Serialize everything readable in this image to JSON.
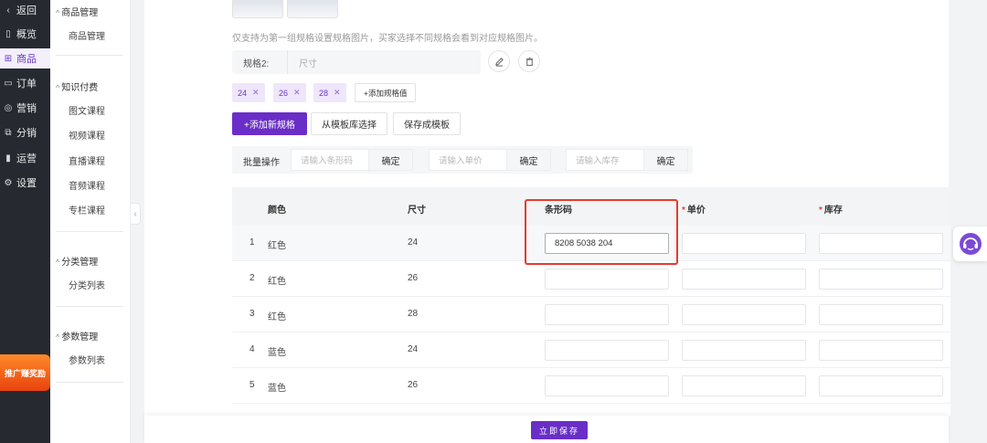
{
  "nav": {
    "items": [
      {
        "icon": "chevron-left-icon",
        "glyph": "‹",
        "label": "返回"
      },
      {
        "icon": "overview-icon",
        "glyph": "▯",
        "label": "概览"
      },
      {
        "icon": "goods-icon",
        "glyph": "⊞",
        "label": "商品",
        "active": true
      },
      {
        "icon": "order-icon",
        "glyph": "▭",
        "label": "订单"
      },
      {
        "icon": "marketing-icon",
        "glyph": "◎",
        "label": "营销"
      },
      {
        "icon": "distribution-icon",
        "glyph": "⧉",
        "label": "分销"
      },
      {
        "icon": "operation-icon",
        "glyph": "▮",
        "label": "运营"
      },
      {
        "icon": "settings-icon",
        "glyph": "⚙",
        "label": "设置"
      }
    ],
    "promo": "推广赚奖励"
  },
  "submenu": {
    "groups": [
      {
        "title": "商品管理",
        "items": [
          "商品管理"
        ]
      },
      {
        "title": "知识付费",
        "items": [
          "图文课程",
          "视频课程",
          "直播课程",
          "音频课程",
          "专栏课程"
        ]
      },
      {
        "title": "分类管理",
        "items": [
          "分类列表"
        ]
      },
      {
        "title": "参数管理",
        "items": [
          "参数列表"
        ]
      }
    ]
  },
  "spec": {
    "hint": "仅支持为第一组规格设置规格图片，买家选择不同规格会看到对应规格图片。",
    "name_label": "规格2:",
    "name_value": "尺寸",
    "tags": [
      "24",
      "26",
      "28"
    ],
    "add_value_label": "+添加规格值",
    "add_spec_label": "+添加新规格",
    "from_template_label": "从模板库选择",
    "save_template_label": "保存成模板"
  },
  "batch": {
    "label": "批量操作",
    "barcode_placeholder": "请输入条形码",
    "price_placeholder": "请输入单价",
    "stock_placeholder": "请输入库存",
    "confirm": "确定"
  },
  "table": {
    "headers": {
      "color": "颜色",
      "size": "尺寸",
      "barcode": "条形码",
      "price": "单价",
      "stock": "库存",
      "required_mark": "*"
    },
    "rows": [
      {
        "index": "1",
        "color": "红色",
        "size": "24",
        "barcode": "8208 5038 204"
      },
      {
        "index": "2",
        "color": "红色",
        "size": "26",
        "barcode": ""
      },
      {
        "index": "3",
        "color": "红色",
        "size": "28",
        "barcode": ""
      },
      {
        "index": "4",
        "color": "蓝色",
        "size": "24",
        "barcode": ""
      },
      {
        "index": "5",
        "color": "蓝色",
        "size": "26",
        "barcode": ""
      }
    ]
  },
  "footer": {
    "save_label": "立即保存"
  },
  "colors": {
    "accent": "#6a2ec8",
    "highlight": "#e53b2c",
    "nav_bg": "#262a30"
  }
}
